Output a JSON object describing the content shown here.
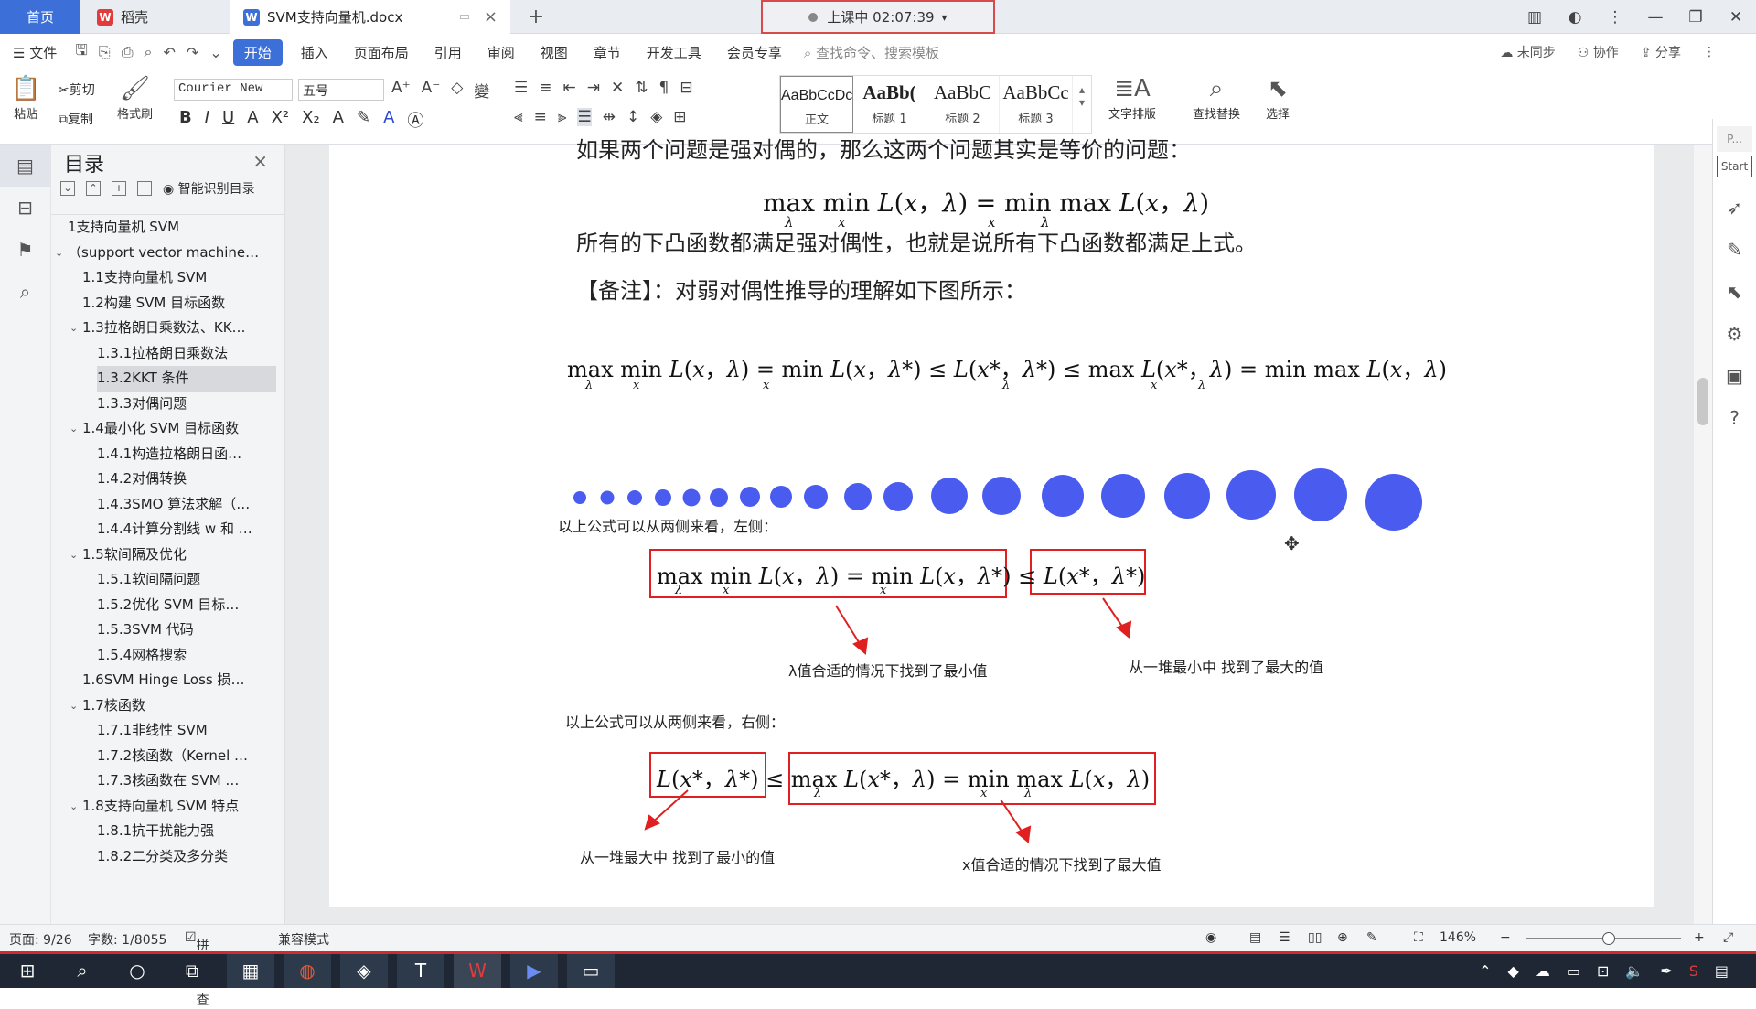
{
  "tabs": {
    "home": "首页",
    "wps": "稻壳",
    "doc": "SVM支持向量机.docx"
  },
  "timer": "上课中 02:07:39",
  "menu": {
    "file": "文件",
    "items": [
      "开始",
      "插入",
      "页面布局",
      "引用",
      "审阅",
      "视图",
      "章节",
      "开发工具",
      "会员专享"
    ],
    "search": "查找命令、搜索模板",
    "right": [
      "未同步",
      "协作",
      "分享"
    ]
  },
  "ribbon": {
    "paste": "粘贴",
    "cut": "剪切",
    "copy": "复制",
    "format_brush": "格式刷",
    "font": "Courier New",
    "size": "五号",
    "styles": [
      {
        "preview": "AaBbCcDc",
        "name": "正文"
      },
      {
        "preview": "AaBb(",
        "name": "标题 1"
      },
      {
        "preview": "AaBbC",
        "name": "标题 2"
      },
      {
        "preview": "AaBbCc",
        "name": "标题 3"
      }
    ],
    "text_layout": "文字排版",
    "find_replace": "查找替换",
    "select": "选择"
  },
  "toc": {
    "title": "目录",
    "smart": "智能识别目录",
    "items": [
      {
        "label": "1支持向量机 SVM",
        "level": 1
      },
      {
        "label": "（support vector machine…",
        "level": 1,
        "arrow": true
      },
      {
        "label": "1.1支持向量机 SVM",
        "level": 2
      },
      {
        "label": "1.2构建 SVM 目标函数",
        "level": 2
      },
      {
        "label": "1.3拉格朗日乘数法、KK…",
        "level": 2,
        "arrow": true
      },
      {
        "label": "1.3.1拉格朗日乘数法",
        "level": 3
      },
      {
        "label": "1.3.2KKT 条件",
        "level": 3,
        "selected": true
      },
      {
        "label": "1.3.3对偶问题",
        "level": 3
      },
      {
        "label": "1.4最小化 SVM 目标函数",
        "level": 2,
        "arrow": true
      },
      {
        "label": "1.4.1构造拉格朗日函…",
        "level": 3
      },
      {
        "label": "1.4.2对偶转换",
        "level": 3
      },
      {
        "label": "1.4.3SMO 算法求解（…",
        "level": 3
      },
      {
        "label": "1.4.4计算分割线 w 和 …",
        "level": 3
      },
      {
        "label": "1.5软间隔及优化",
        "level": 2,
        "arrow": true
      },
      {
        "label": "1.5.1软间隔问题",
        "level": 3
      },
      {
        "label": "1.5.2优化 SVM 目标…",
        "level": 3
      },
      {
        "label": "1.5.3SVM 代码",
        "level": 3
      },
      {
        "label": "1.5.4网格搜索",
        "level": 3
      },
      {
        "label": "1.6SVM Hinge Loss 损…",
        "level": 2
      },
      {
        "label": "1.7核函数",
        "level": 2,
        "arrow": true
      },
      {
        "label": "1.7.1非线性 SVM",
        "level": 3
      },
      {
        "label": "1.7.2核函数（Kernel …",
        "level": 3
      },
      {
        "label": "1.7.3核函数在 SVM …",
        "level": 3
      },
      {
        "label": "1.8支持向量机 SVM 特点",
        "level": 2,
        "arrow": true
      },
      {
        "label": "1.8.1抗干扰能力强",
        "level": 3
      },
      {
        "label": "1.8.2二分类及多分类",
        "level": 3
      }
    ]
  },
  "doc": {
    "line_top": "如果两个问题是强对偶的，那么这两个问题其实是等价的问题：",
    "para1": "所有的下凸函数都满足强对偶性，也就是说所有下凸函数都满足上式。",
    "para2": "【备注】：对弱对偶性推导的理解如下图所示：",
    "note_left": "以上公式可以从两侧来看，左侧：",
    "note_right": "以上公式可以从两侧来看，右侧：",
    "ann1": "λ值合适的情况下找到了最小值",
    "ann2": "从一堆最小中 找到了最大的值",
    "ann3": "从一堆最大中 找到了最小的值",
    "ann4": "x值合适的情况下找到了最大值"
  },
  "status": {
    "page": "页面: 9/26",
    "words": "字数: 1/8055",
    "spell": "拼写检查",
    "compat": "兼容模式",
    "zoom": "146%"
  },
  "rightpanel": {
    "start": "Start",
    "p": "P..."
  },
  "colors": {
    "accent": "#3c6fd8",
    "red": "#e02020",
    "dot": "#4a5bf0"
  }
}
